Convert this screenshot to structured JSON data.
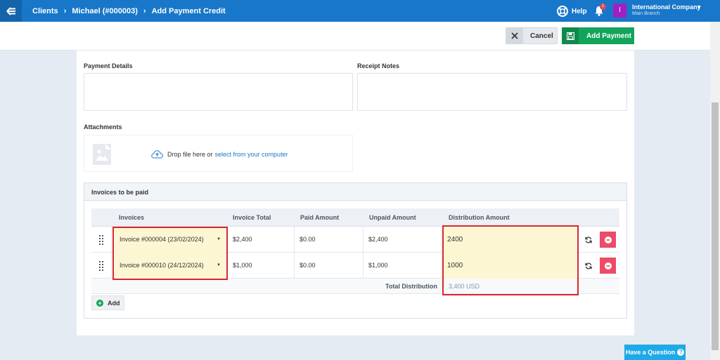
{
  "breadcrumb": {
    "items": [
      "Clients",
      "Michael (#000003)",
      "Add Payment Credit"
    ]
  },
  "header": {
    "help_label": "Help",
    "notification_count": "1",
    "avatar_letter": "I",
    "company_name": "International Company",
    "branch_name": "Main Branch"
  },
  "actions": {
    "cancel_label": "Cancel",
    "add_payment_label": "Add Payment"
  },
  "form": {
    "payment_details_label": "Payment Details",
    "receipt_notes_label": "Receipt Notes",
    "attachments_label": "Attachments",
    "drop_text": "Drop file here or",
    "drop_link": "select from your computer"
  },
  "invoices": {
    "section_title": "Invoices to be paid",
    "columns": [
      "Invoices",
      "Invoice Total",
      "Paid Amount",
      "Unpaid Amount",
      "Distribution Amount"
    ],
    "rows": [
      {
        "invoice": "Invoice #000004 (23/02/2024)",
        "total": "$2,400",
        "paid": "$0.00",
        "unpaid": "$2,400",
        "distribution": "2400"
      },
      {
        "invoice": "Invoice #000010 (24/12/2024)",
        "total": "$1,000",
        "paid": "$0.00",
        "unpaid": "$1,000",
        "distribution": "1000"
      }
    ],
    "total_label": "Total Distribution",
    "total_value": "3,400 USD",
    "add_label": "Add"
  },
  "question_label": "Have a Question",
  "colors": {
    "nav": "#1877c9",
    "success": "#13a45b",
    "danger": "#ee4b66",
    "highlight": "#d9262f",
    "field_fill": "#fdf6d3"
  }
}
